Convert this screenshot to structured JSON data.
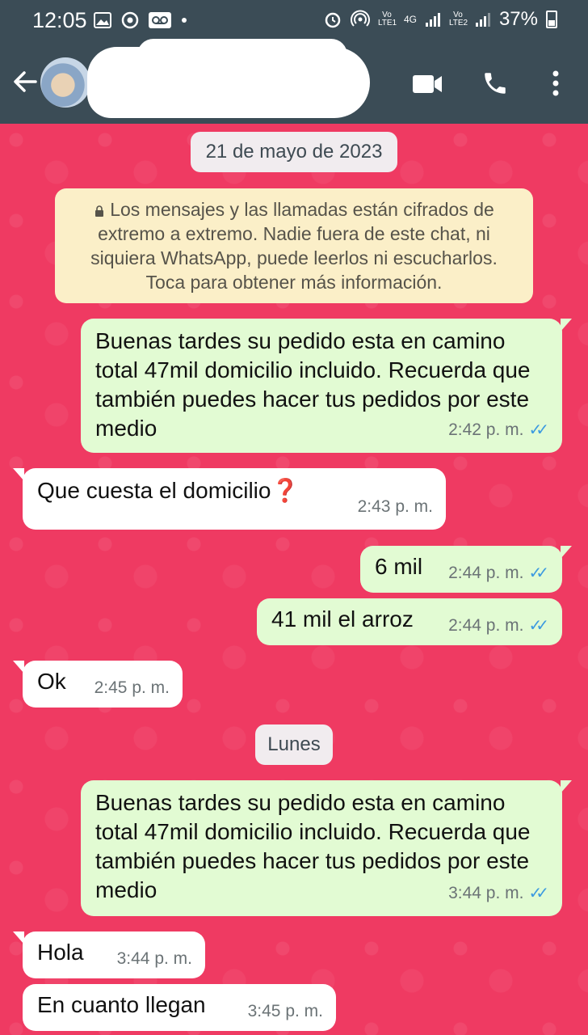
{
  "status_bar": {
    "time": "12:05",
    "volte1": "Vo LTE1",
    "network": "4G",
    "volte2": "Vo LTE2",
    "battery": "37%"
  },
  "header": {
    "icons": [
      "back-arrow-icon",
      "video-call-icon",
      "phone-icon",
      "more-vert-icon"
    ]
  },
  "chat": {
    "date_separators": [
      "21 de mayo de 2023",
      "Lunes"
    ],
    "encryption_notice": "Los mensajes y las llamadas están cifrados de extremo a extremo. Nadie fuera de este chat, ni siquiera WhatsApp, puede leerlos ni escucharlos. Toca para obtener más información.",
    "messages": [
      {
        "direction": "out",
        "text": "Buenas tardes su pedido esta en camino total 47mil domicilio incluido. Recuerda que también puedes hacer  tus pedidos por este medio",
        "time": "2:42 p. m.",
        "read": true
      },
      {
        "direction": "in",
        "text": "Que cuesta el domicilio",
        "emoji": "❓",
        "time": "2:43 p. m."
      },
      {
        "direction": "out",
        "text": "6 mil",
        "time": "2:44 p. m.",
        "read": true
      },
      {
        "direction": "out",
        "text": "41 mil el arroz",
        "time": "2:44 p. m.",
        "read": true
      },
      {
        "direction": "in",
        "text": "Ok",
        "time": "2:45 p. m."
      },
      {
        "direction": "out",
        "text": "Buenas tardes su pedido esta en camino total 47mil domicilio incluido. Recuerda que también puedes hacer  tus pedidos por este medio",
        "time": "3:44 p. m.",
        "read": true
      },
      {
        "direction": "in",
        "text": "Hola",
        "time": "3:44 p. m."
      },
      {
        "direction": "in",
        "text": "En cuanto llegan",
        "time": "3:45 p. m."
      }
    ]
  },
  "colors": {
    "header": "#3b4c56",
    "wallpaper": "#ef3a62",
    "outgoing_bubble": "#e2fbd3",
    "incoming_bubble": "#ffffff",
    "notice_bg": "#fbefc8",
    "read_ticks": "#3c9ae0"
  }
}
